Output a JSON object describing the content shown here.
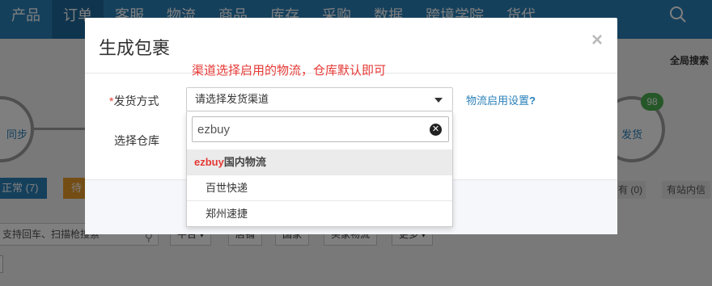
{
  "topnav": {
    "items": [
      "产品",
      "订单",
      "客服",
      "物流",
      "商品",
      "库存",
      "采购",
      "数据",
      "跨境学院",
      "货代"
    ],
    "active_index": 1
  },
  "background": {
    "global_search": "全局搜索",
    "step_left_label": "同步",
    "step_right_label": "发货",
    "step_right_badge": "98",
    "tab_normal": "正常 (7)",
    "tab_wait": "待",
    "tab_right1": "有 (0)",
    "tab_right2": "有站内信",
    "search_placeholder": "支持回车、扫描枪搜索",
    "filter_buttons": [
      "平台 ▾",
      "店铺",
      "国家",
      "买家物流",
      "更多 ▾"
    ]
  },
  "modal": {
    "title": "生成包裹",
    "close": "×",
    "hint": "渠道选择启用的物流，仓库默认即可",
    "ship_label_star": "*",
    "ship_label": "发货方式",
    "warehouse_label": "选择仓库",
    "select_value": "请选择发货渠道",
    "help_link": "物流启用设置",
    "help_q": "?"
  },
  "dropdown": {
    "search_value": "ezbuy",
    "group_highlight": "ezbuy",
    "group_rest": "国内物流",
    "options": [
      "百世快递",
      "郑州速捷"
    ]
  },
  "colors": {
    "nav": "#2a80b9",
    "accent_red": "#e53935",
    "badge_green": "#4caf50"
  }
}
